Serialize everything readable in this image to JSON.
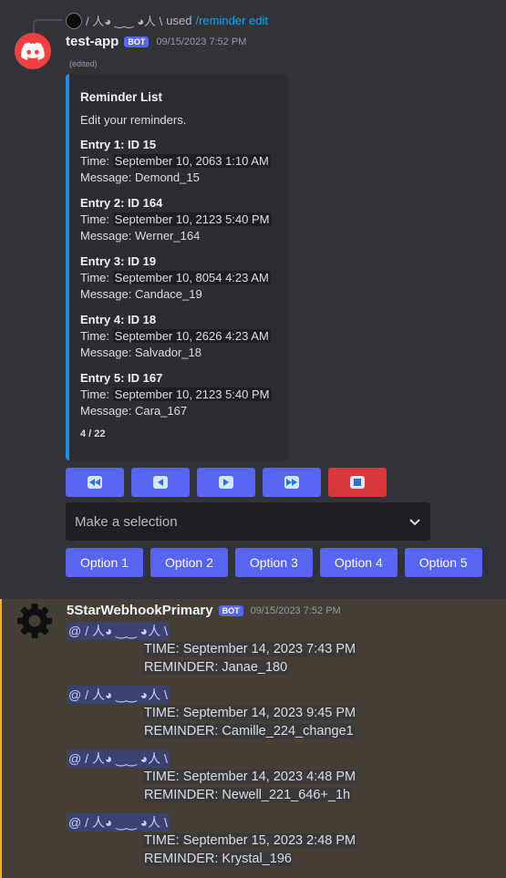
{
  "reply": {
    "user": "/ 人◕ ‿‿ ◕人 \\",
    "used_text": "used",
    "command": "/reminder edit"
  },
  "message1": {
    "username": "test-app",
    "bot_tag": "BOT",
    "timestamp": "09/15/2023 7:52 PM",
    "edited": "(edited)",
    "embed": {
      "accent_color": "#1f8ee3",
      "title": "Reminder List",
      "description": "Edit your reminders.",
      "time_prefix": "Time:",
      "message_prefix": "Message:",
      "entries": [
        {
          "title": "Entry 1: ID 15",
          "time": "September 10, 2063 1:10 AM",
          "message": "Demond_15"
        },
        {
          "title": "Entry 2: ID 164",
          "time": "September 10, 2123 5:40 PM",
          "message": "Werner_164"
        },
        {
          "title": "Entry 3: ID 19",
          "time": "September 10, 8054 4:23 AM",
          "message": "Candace_19"
        },
        {
          "title": "Entry 4: ID 18",
          "time": "September 10, 2626 4:23 AM",
          "message": "Salvador_18"
        },
        {
          "title": "Entry 5: ID 167",
          "time": "September 10, 2123 5:40 PM",
          "message": "Cara_167"
        }
      ],
      "footer": "4 / 22"
    },
    "nav_buttons": [
      {
        "icon": "first-page-icon",
        "style": "primary"
      },
      {
        "icon": "previous-page-icon",
        "style": "primary"
      },
      {
        "icon": "next-page-icon",
        "style": "primary"
      },
      {
        "icon": "last-page-icon",
        "style": "primary"
      },
      {
        "icon": "stop-icon",
        "style": "danger"
      }
    ],
    "select_placeholder": "Make a selection",
    "options": [
      "Option 1",
      "Option 2",
      "Option 3",
      "Option 4",
      "Option 5"
    ]
  },
  "message2": {
    "username": "5StarWebhookPrimary",
    "bot_tag": "BOT",
    "timestamp": "09/15/2023 7:52 PM",
    "highlight_color": "#f0b232",
    "mention": "@ / 人◕ ‿‿ ◕人 \\",
    "time_prefix": "TIME:",
    "reminder_prefix": "REMINDER:",
    "reminders": [
      {
        "time": "September 14, 2023 7:43 PM",
        "reminder": "Janae_180"
      },
      {
        "time": "September 14, 2023 9:45 PM",
        "reminder": "Camille_224_change1"
      },
      {
        "time": "September 14, 2023 4:48 PM",
        "reminder": "Newell_221_646+_1h"
      },
      {
        "time": "September 15, 2023 2:48 PM",
        "reminder": "Krystal_196"
      }
    ]
  }
}
